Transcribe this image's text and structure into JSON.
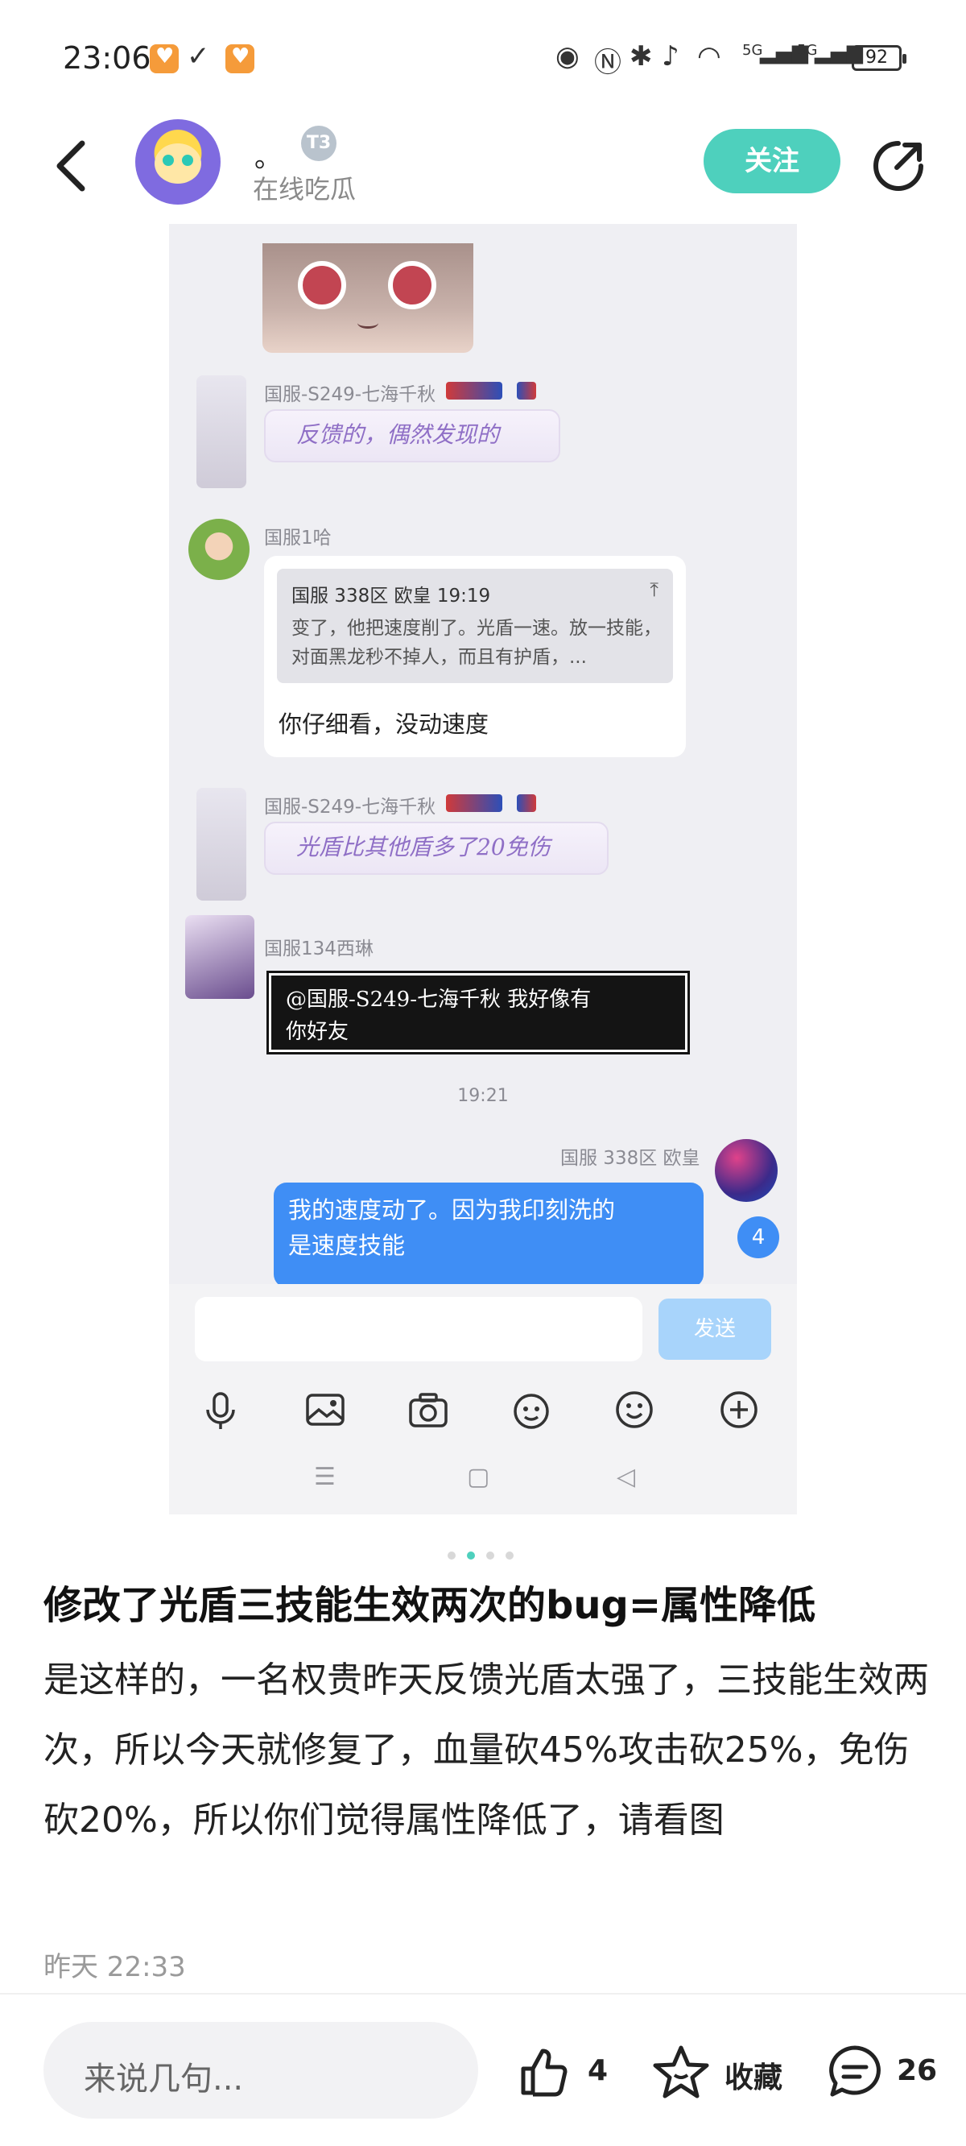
{
  "status_bar": {
    "time": "23:06",
    "signal_1": "5G",
    "signal_2": "5G",
    "battery": "92"
  },
  "header": {
    "username": "。",
    "badge": "T3",
    "user_status": "在线吃瓜",
    "follow_label": "关注"
  },
  "screenshot": {
    "msg1": {
      "sender": "国服-S249-七海千秋",
      "sticker_text": "反馈的，偶然发现的"
    },
    "msg2": {
      "sender": "国服1哈",
      "quote_header": "国服 338区 欧皇 19:19",
      "quote_text": "变了，他把速度削了。光盾一速。放一技能，对面黑龙秒不掉人，而且有护盾，...",
      "reply": "你仔细看，没动速度"
    },
    "msg3": {
      "sender": "国服-S249-七海千秋",
      "sticker_text": "光盾比其他盾多了20免伤"
    },
    "msg4": {
      "sender": "国服134西琳",
      "text_line1": "@国服-S249-七海千秋 我好像有",
      "text_line2": "你好友"
    },
    "time_separator": "19:21",
    "msg5": {
      "sender": "国服 338区 欧皇",
      "text_line1": "我的速度动了。因为我印刻洗的",
      "text_line2": "是速度技能",
      "unread": "4"
    },
    "send_label": "发送"
  },
  "post": {
    "title": "修改了光盾三技能生效两次的bug=属性降低",
    "body": "是这样的，一名权贵昨天反馈光盾太强了，三技能生效两次，所以今天就修复了，血量砍45%攻击砍25%，免伤砍20%，所以你们觉得属性降低了，请看图",
    "time": "昨天 22:33"
  },
  "bottom_bar": {
    "comment_placeholder": "来说几句...",
    "like_count": "4",
    "favorite_label": "收藏",
    "comment_count": "26"
  },
  "colors": {
    "accent": "#4ed0bd",
    "chat_blue": "#3f8ef5"
  }
}
